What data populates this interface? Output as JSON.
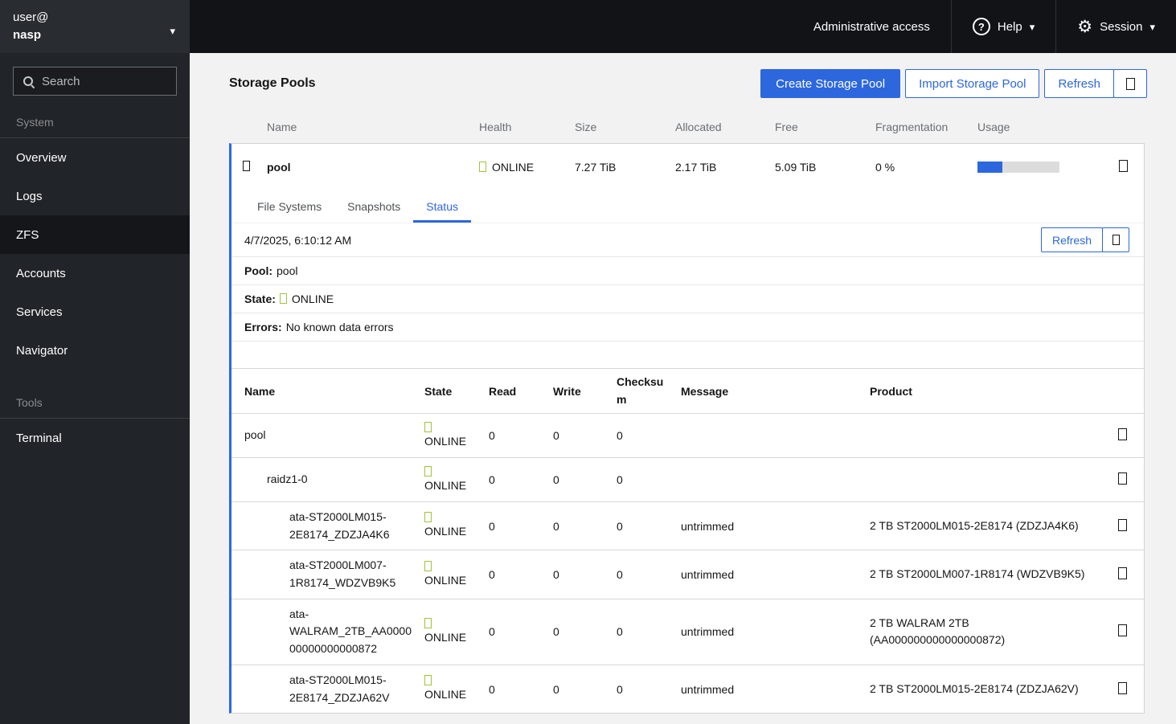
{
  "masthead": {
    "brand_user": "user@",
    "brand_host": "nasp",
    "admin_access_label": "Administrative access",
    "help_label": "Help",
    "session_label": "Session"
  },
  "sidebar": {
    "search_placeholder": "Search",
    "groups": [
      {
        "label": "System",
        "items": [
          {
            "label": "Overview"
          },
          {
            "label": "Logs"
          },
          {
            "label": "ZFS",
            "active": true
          },
          {
            "label": "Accounts"
          },
          {
            "label": "Services"
          },
          {
            "label": "Navigator"
          }
        ]
      },
      {
        "label": "Tools",
        "items": [
          {
            "label": "Terminal"
          }
        ]
      }
    ]
  },
  "main": {
    "title": "Storage Pools",
    "buttons": {
      "create": "Create Storage Pool",
      "import": "Import Storage Pool",
      "refresh": "Refresh"
    },
    "pools_table": {
      "columns": {
        "name": "Name",
        "health": "Health",
        "size": "Size",
        "allocated": "Allocated",
        "free": "Free",
        "fragmentation": "Fragmentation",
        "usage": "Usage"
      },
      "pool_row": {
        "name": "pool",
        "health": "ONLINE",
        "size": "7.27 TiB",
        "allocated": "2.17 TiB",
        "free": "5.09 TiB",
        "fragmentation": "0 %",
        "usage_percent": 30
      }
    },
    "tabs": [
      {
        "label": "File Systems"
      },
      {
        "label": "Snapshots"
      },
      {
        "label": "Status",
        "active": true
      }
    ],
    "status": {
      "timestamp": "4/7/2025, 6:10:12 AM",
      "refresh_label": "Refresh",
      "pool_label": "Pool:",
      "pool_value": "pool",
      "state_label": "State:",
      "state_value": "ONLINE",
      "errors_label": "Errors:",
      "errors_value": "No known data errors",
      "device_table": {
        "columns": {
          "name": "Name",
          "state": "State",
          "read": "Read",
          "write": "Write",
          "checksum": "Checksum",
          "message": "Message",
          "product": "Product"
        },
        "rows": [
          {
            "name": "pool",
            "state": "ONLINE",
            "read": "0",
            "write": "0",
            "checksum": "0",
            "message": "",
            "product": ""
          },
          {
            "name": "raidz1-0",
            "state": "ONLINE",
            "read": "0",
            "write": "0",
            "checksum": "0",
            "message": "",
            "product": ""
          },
          {
            "name": "ata-ST2000LM015-2E8174_ZDZJA4K6",
            "state": "ONLINE",
            "read": "0",
            "write": "0",
            "checksum": "0",
            "message": "untrimmed",
            "product": "2 TB ST2000LM015-2E8174 (ZDZJA4K6)"
          },
          {
            "name": "ata-ST2000LM007-1R8174_WDZVB9K5",
            "state": "ONLINE",
            "read": "0",
            "write": "0",
            "checksum": "0",
            "message": "untrimmed",
            "product": "2 TB ST2000LM007-1R8174 (WDZVB9K5)"
          },
          {
            "name": "ata-WALRAM_2TB_AA000000000000000872",
            "state": "ONLINE",
            "read": "0",
            "write": "0",
            "checksum": "0",
            "message": "untrimmed",
            "product": "2 TB WALRAM 2TB (AA000000000000000872)"
          },
          {
            "name": "ata-ST2000LM015-2E8174_ZDZJA62V",
            "state": "ONLINE",
            "read": "0",
            "write": "0",
            "checksum": "0",
            "message": "untrimmed",
            "product": "2 TB ST2000LM015-2E8174 (ZDZJA62V)"
          }
        ]
      }
    }
  },
  "icons": {
    "search": "magnifier",
    "help": "question-circle",
    "session": "gear",
    "dropdown": "caret-down",
    "expand_toggle": "missing-glyph-box",
    "status_online": "missing-glyph-box",
    "kebab_menu": "missing-glyph-box",
    "refresh_extra": "missing-glyph-box"
  },
  "colors": {
    "primary_blue": "#2c67de",
    "online_green": "#9fc33c",
    "masthead_bg": "#111317",
    "brand_bg": "#292c31",
    "sidebar_bg": "#212428",
    "content_bg": "#f2f2f2",
    "card_bg": "#ffffff"
  }
}
